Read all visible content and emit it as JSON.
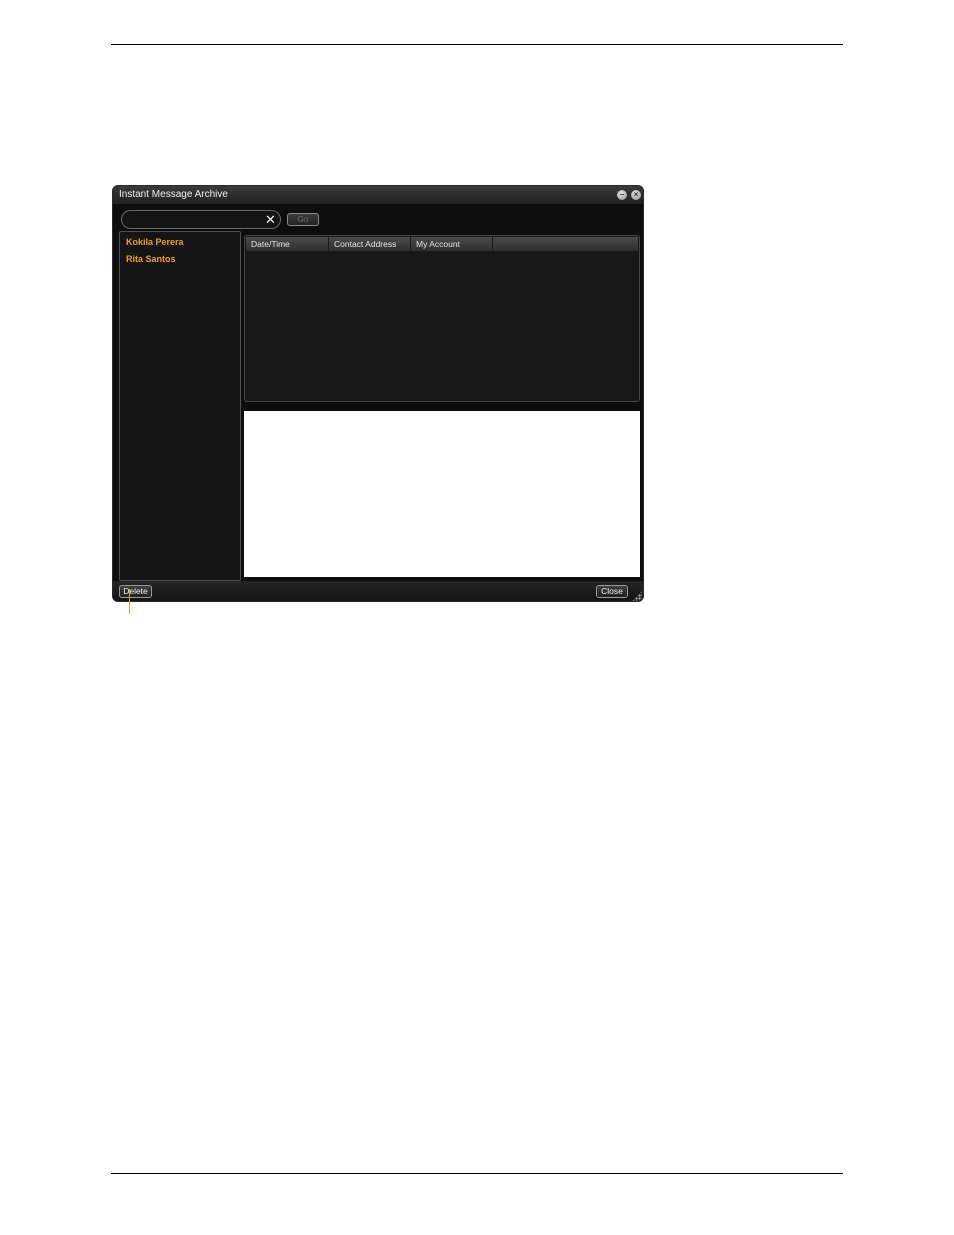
{
  "window": {
    "title": "Instant Message Archive"
  },
  "search": {
    "value": "",
    "go_label": "Go"
  },
  "contacts": [
    {
      "name": "Kokila Perera"
    },
    {
      "name": "Rita Santos"
    }
  ],
  "table": {
    "columns": [
      "Date/Time",
      "Contact Address",
      "My Account"
    ],
    "rows": []
  },
  "footer": {
    "delete_label": "Delete",
    "close_label": "Close"
  },
  "colors": {
    "contact_text": "#f0a02a",
    "window_bg": "#0d0d0d"
  }
}
